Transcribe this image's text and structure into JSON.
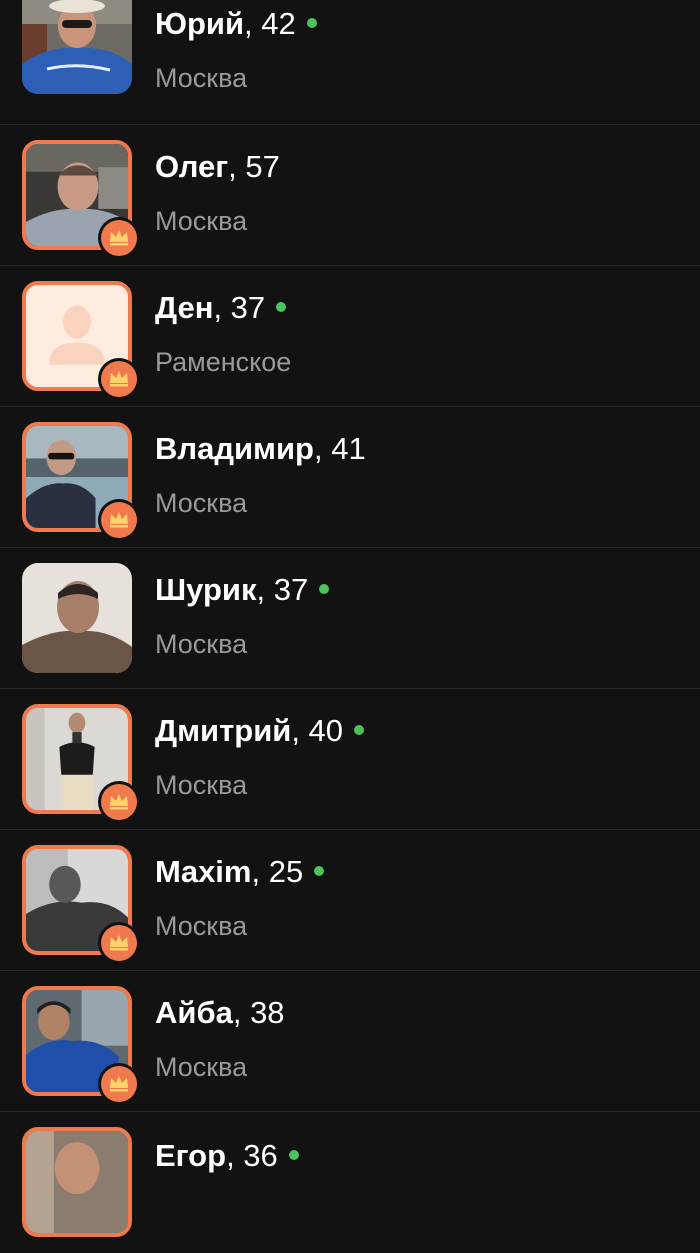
{
  "colors": {
    "background": "#121212",
    "premium_accent": "#f07a4e",
    "online": "#4cc35b",
    "secondary_text": "#9a9a9a"
  },
  "users": [
    {
      "name": "Юрий",
      "age": ", 42",
      "city": "Москва",
      "online": true,
      "premium": false
    },
    {
      "name": "Олег",
      "age": ", 57",
      "city": "Москва",
      "online": false,
      "premium": true
    },
    {
      "name": "Ден",
      "age": ", 37",
      "city": "Раменское",
      "online": true,
      "premium": true
    },
    {
      "name": "Владимир",
      "age": ", 41",
      "city": "Москва",
      "online": false,
      "premium": true
    },
    {
      "name": "Шурик",
      "age": ", 37",
      "city": "Москва",
      "online": true,
      "premium": false
    },
    {
      "name": "Дмитрий",
      "age": ", 40",
      "city": "Москва",
      "online": true,
      "premium": true
    },
    {
      "name": "Maxim",
      "age": ", 25",
      "city": "Москва",
      "online": true,
      "premium": true
    },
    {
      "name": "Айба",
      "age": ", 38",
      "city": "Москва",
      "online": false,
      "premium": true
    },
    {
      "name": "Егор",
      "age": ", 36",
      "city": "",
      "online": true,
      "premium": true
    }
  ]
}
